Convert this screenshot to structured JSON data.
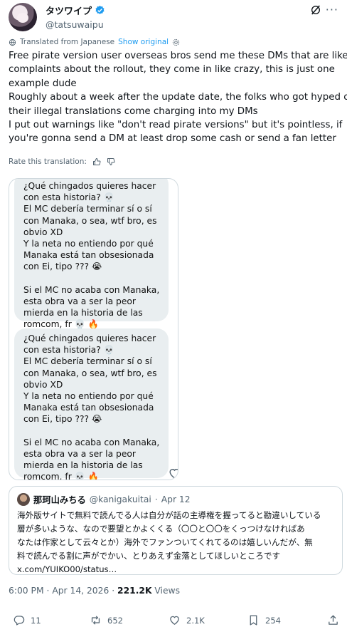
{
  "author": {
    "display_name": "タツワイプ",
    "handle": "@tatsuwaipu"
  },
  "translation": {
    "label": "Translated from Japanese",
    "show_original": "Show original",
    "rate_label": "Rate this translation:"
  },
  "tweet": {
    "lines": [
      "Free pirate version user overseas bros send me these DMs that are like",
      "complaints about the rollout, they come in like crazy, this is just one",
      "example dude",
      "Roughly about a week after the update date, the folks who got hyped on",
      "their illegal translations come charging into my DMs",
      "I put out warnings like \"don't read pirate versions\" but it's pointless, if",
      "you're gonna send a DM at least drop some cash or send a fan letter"
    ]
  },
  "media": {
    "bubble1_lines": [
      "¿Qué chingados quieres hacer",
      "con esta historia? 💀",
      "El MC debería terminar sí o sí",
      "con Manaka, o sea, wtf bro, es",
      "obvio XD",
      "Y la neta no entiendo por qué",
      "Manaka está tan obsesionada",
      "con Ei, tipo ??? 😭",
      "",
      "Si el MC no acaba con Manaka,",
      "esta obra va a ser la peor",
      "mierda en la historia de las",
      "romcom, fr 💀 🔥"
    ],
    "bubble2_lines": [
      "¿Qué chingados quieres hacer",
      "con esta historia? 💀",
      "El MC debería terminar sí o sí",
      "con Manaka, o sea, wtf bro, es",
      "obvio XD",
      "Y la neta no entiendo por qué",
      "Manaka está tan obsesionada",
      "con Ei, tipo ??? 😭",
      "",
      "Si el MC no acaba con Manaka,",
      "esta obra va a ser la peor",
      "mierda en la historia de las",
      "romcom, fr 💀 🔥"
    ]
  },
  "quote": {
    "name": "那珂山みちる",
    "handle": "@kanigakuitai",
    "date": "Apr 12",
    "lines": [
      "海外版サイトで無料で読んでる人は自分が話の主導権を握ってると勘違いしている",
      "層が多いような、なので要望とかよくくる（〇〇と〇〇をくっつけなければあ",
      "なたは作家として云々とか）海外でファンついてくれてるのは嬉しいんだが、無",
      "料で読んでる割に声がでかい、とりあえず金落としてほしいところです",
      "x.com/YUIKO00/status…"
    ]
  },
  "meta": {
    "time": "6:00 PM",
    "date": "Apr 14, 2026",
    "views_count": "221.2K",
    "views_label": "Views",
    "separator": "·"
  },
  "actions": {
    "replies": "11",
    "reposts": "652",
    "likes": "2.1K",
    "bookmarks": "254"
  },
  "colors": {
    "accent": "#1d9bf0",
    "muted": "#536471",
    "bubble": "#e9eef0",
    "verified": "#1d9bf0"
  }
}
